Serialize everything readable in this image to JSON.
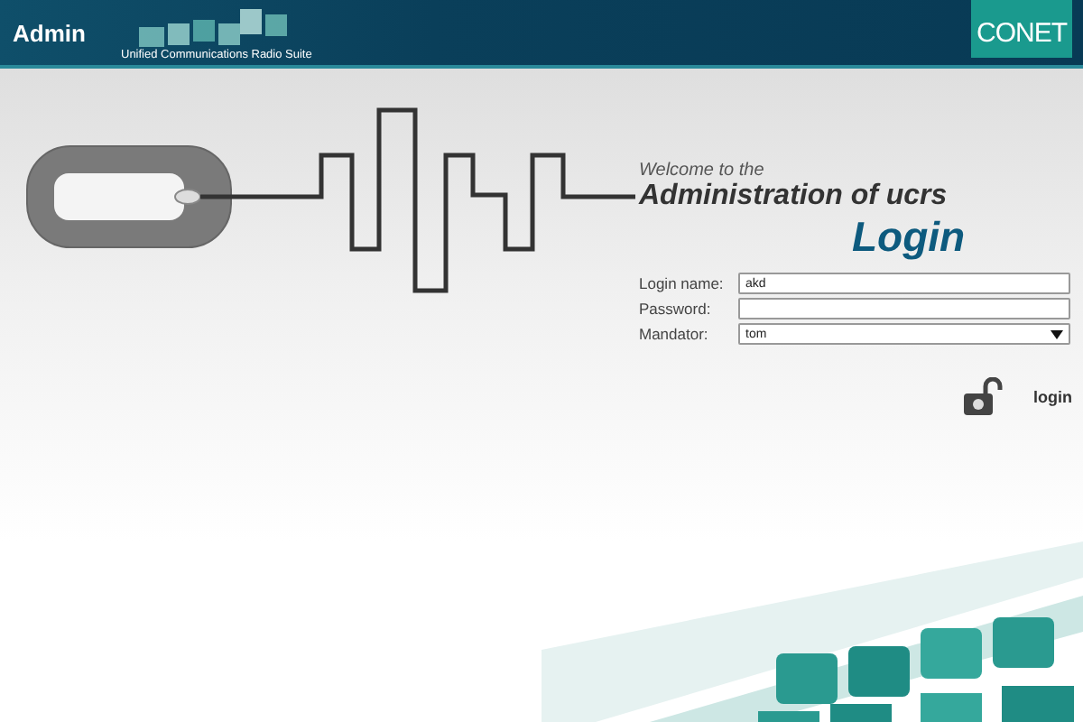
{
  "header": {
    "title": "Admin",
    "suite_name": "Unified Communications Radio Suite",
    "brand": "CONET"
  },
  "welcome": {
    "greeting": "Welcome to the",
    "heading": "Administration of ucrs"
  },
  "login": {
    "title": "Login",
    "fields": [
      {
        "kind": "text",
        "label": "Login name:",
        "value": "akd"
      },
      {
        "kind": "password",
        "label": "Password:"
      },
      {
        "kind": "select",
        "label": "Mandator:",
        "value": "tom"
      }
    ],
    "button": "login"
  }
}
